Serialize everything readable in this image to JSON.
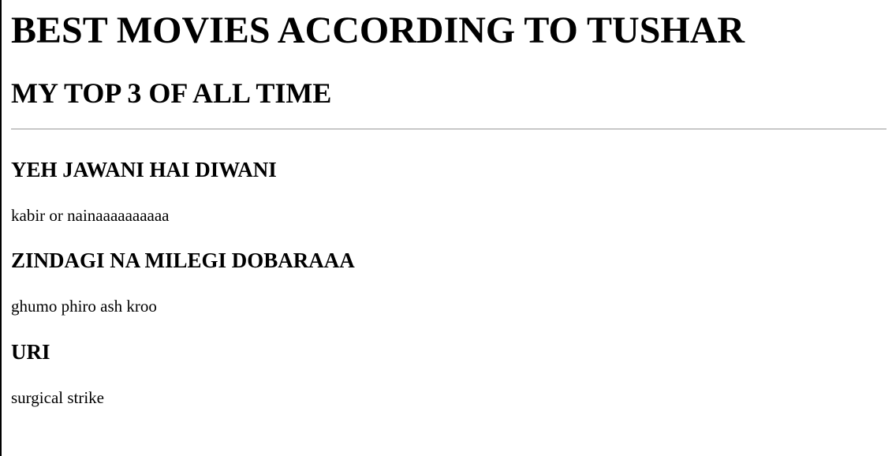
{
  "page": {
    "title": "BEST MOVIES ACCORDING TO TUSHAR",
    "subtitle": "MY TOP 3 OF ALL TIME",
    "movies": [
      {
        "title": "YEH JAWANI HAI DIWANI",
        "description": "kabir or nainaaaaaaaaaa"
      },
      {
        "title": "ZINDAGI NA MILEGI DOBARAAA",
        "description": "ghumo phiro ash kroo"
      },
      {
        "title": "URI",
        "description": "surgical strike"
      }
    ]
  }
}
